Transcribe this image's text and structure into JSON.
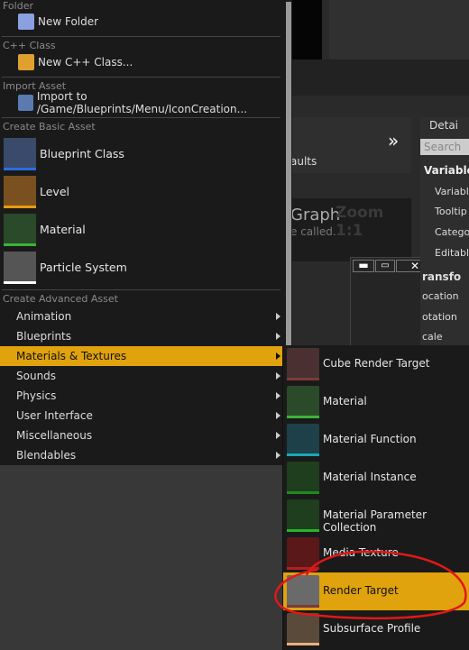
{
  "menu": {
    "sections": {
      "folder": "Folder",
      "cpp": "C++ Class",
      "import": "Import Asset",
      "basic": "Create Basic Asset",
      "advanced": "Create Advanced Asset"
    },
    "new_folder": "New Folder",
    "new_cpp": "New C++ Class...",
    "import_to": "Import to /Game/Blueprints/Menu/IconCreation...",
    "basic_items": [
      {
        "label": "Blueprint Class",
        "color": "#2a6ee0"
      },
      {
        "label": "Level",
        "color": "#e89a10"
      },
      {
        "label": "Material",
        "color": "#38b438"
      },
      {
        "label": "Particle System",
        "color": "#ffffff"
      }
    ],
    "advanced_items": [
      "Animation",
      "Blueprints",
      "Materials & Textures",
      "Sounds",
      "Physics",
      "User Interface",
      "Miscellaneous",
      "Blendables"
    ],
    "highlighted": "Materials & Textures"
  },
  "submenu": {
    "items": [
      {
        "label": "Cube Render Target",
        "color": "#7a3a3a"
      },
      {
        "label": "Material",
        "color": "#38b438"
      },
      {
        "label": "Material Function",
        "color": "#18a8b8"
      },
      {
        "label": "Material Instance",
        "color": "#1e8a1e"
      },
      {
        "label": "Material Parameter Collection",
        "color": "#28b428"
      },
      {
        "label": "Media Texture",
        "color": "#b02020"
      },
      {
        "label": "Render Target",
        "color": "#7a3a3a"
      },
      {
        "label": "Subsurface Profile",
        "color": "#e8b080"
      }
    ],
    "highlighted": "Render Target"
  },
  "background": {
    "defaults": "aults",
    "graph": "Graph",
    "zoom": "Zoom 1:1",
    "called": "e called.",
    "details": "Detai",
    "search": "Search",
    "variable_header": "Variable",
    "rows": [
      "Variable",
      "Tooltip",
      "Categor",
      "Editable"
    ],
    "transform": "ransfo",
    "location": "ocation",
    "rotation": "otation",
    "scale": "cale"
  },
  "accent": "#e0a20d",
  "annotation_color": "#e01818"
}
